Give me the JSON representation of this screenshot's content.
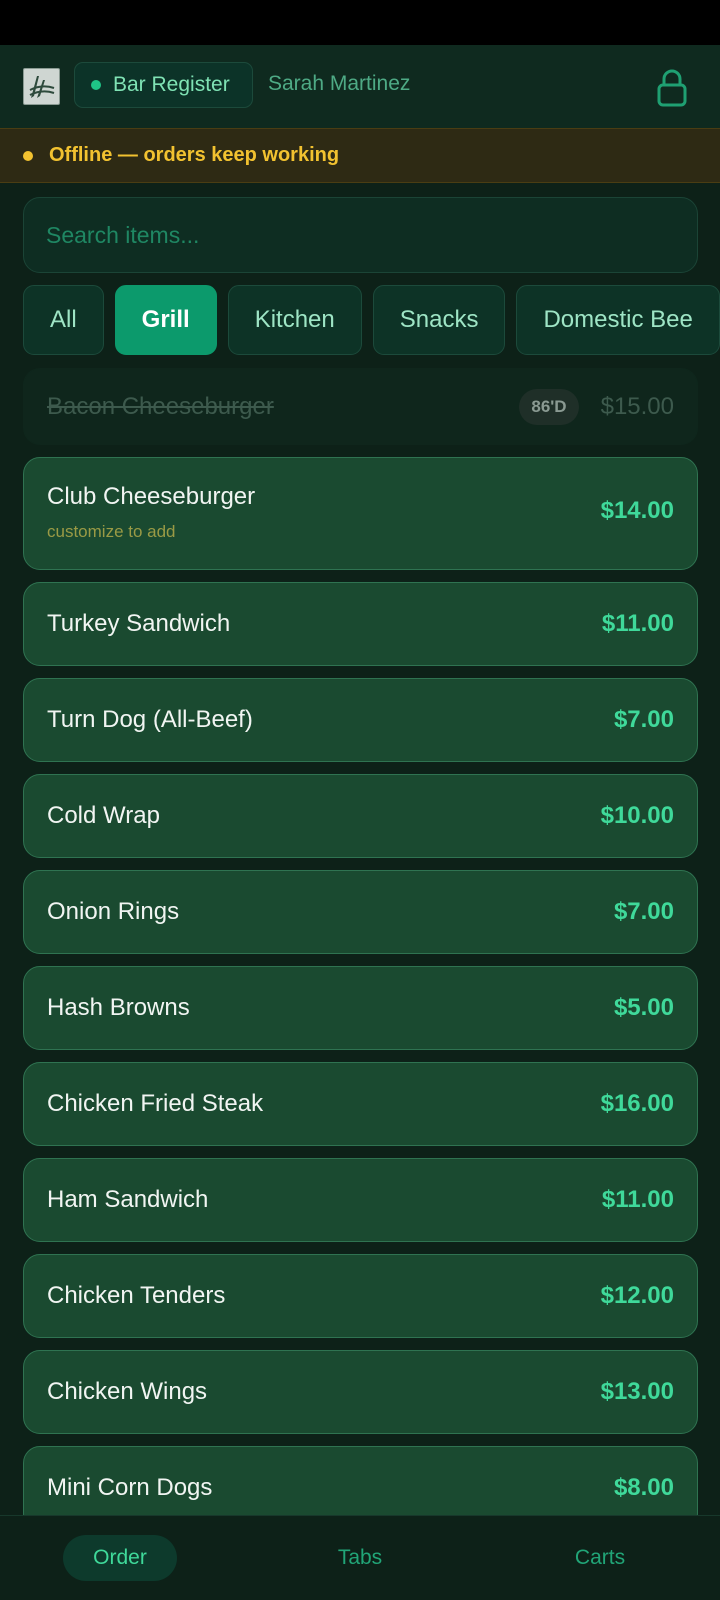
{
  "header": {
    "register_label": "Bar Register",
    "user_name": "Sarah Martinez",
    "logo_icon": "app-logo",
    "lock_icon": "lock-icon"
  },
  "banner": {
    "text": "Offline — orders keep working"
  },
  "search": {
    "placeholder": "Search items..."
  },
  "categories": [
    {
      "label": "All",
      "active": false
    },
    {
      "label": "Grill",
      "active": true
    },
    {
      "label": "Kitchen",
      "active": false
    },
    {
      "label": "Snacks",
      "active": false
    },
    {
      "label": "Domestic Bee",
      "active": false
    }
  ],
  "items": [
    {
      "name": "Bacon Cheeseburger",
      "price": "$15.00",
      "badge": "86'D",
      "sold_out": true
    },
    {
      "name": "Club Cheeseburger",
      "price": "$14.00",
      "subtitle": "customize to add"
    },
    {
      "name": "Turkey Sandwich",
      "price": "$11.00"
    },
    {
      "name": "Turn Dog (All-Beef)",
      "price": "$7.00"
    },
    {
      "name": "Cold Wrap",
      "price": "$10.00"
    },
    {
      "name": "Onion Rings",
      "price": "$7.00"
    },
    {
      "name": "Hash Browns",
      "price": "$5.00"
    },
    {
      "name": "Chicken Fried Steak",
      "price": "$16.00"
    },
    {
      "name": "Ham Sandwich",
      "price": "$11.00"
    },
    {
      "name": "Chicken Tenders",
      "price": "$12.00"
    },
    {
      "name": "Chicken Wings",
      "price": "$13.00"
    },
    {
      "name": "Mini Corn Dogs",
      "price": "$8.00"
    }
  ],
  "nav": [
    {
      "label": "Order",
      "active": true
    },
    {
      "label": "Tabs",
      "active": false
    },
    {
      "label": "Carts",
      "active": false
    }
  ],
  "colors": {
    "accent": "#0c9a6c",
    "price": "#3fd99a",
    "warning": "#f2c230",
    "background": "#0d2118"
  }
}
